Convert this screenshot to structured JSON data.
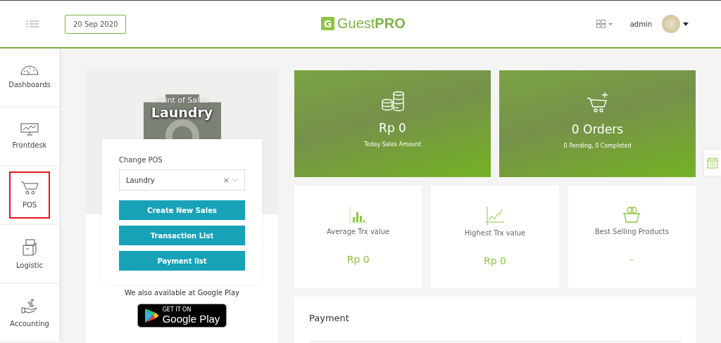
{
  "header": {
    "date": "20 Sep 2020",
    "logo_mark": "G",
    "logo_text": "Guest**PRO**",
    "user": "admin"
  },
  "sidebar": {
    "items": [
      {
        "label": "Dashboards",
        "selected": false
      },
      {
        "label": "Frontdesk",
        "selected": false
      },
      {
        "label": "POS",
        "selected": true
      },
      {
        "label": "Logistic",
        "selected": false
      },
      {
        "label": "Accounting",
        "selected": false
      }
    ]
  },
  "pos_card": {
    "subtitle": "Point of Sales",
    "title": "Laundry",
    "change_label": "Change POS",
    "select_value": "Laundry",
    "clear": "×",
    "buttons": [
      "Create New Sales",
      "Transaction List",
      "Payment list"
    ],
    "store_note": "We also available at Google Play",
    "badge_small": "GET IT ON",
    "badge_big": "Google Play"
  },
  "summary": [
    {
      "value": "Rp 0",
      "caption": "Today Sales Amount"
    },
    {
      "value": "0 Orders",
      "caption": "0 Pending, 0 Completed"
    }
  ],
  "stats": [
    {
      "label": "Average Trx value",
      "value": "Rp 0"
    },
    {
      "label": "Highest Trx value",
      "value": "Rp 0"
    },
    {
      "label": "Best Selling Products",
      "value": "-"
    }
  ],
  "payment": {
    "title": "Payment"
  }
}
